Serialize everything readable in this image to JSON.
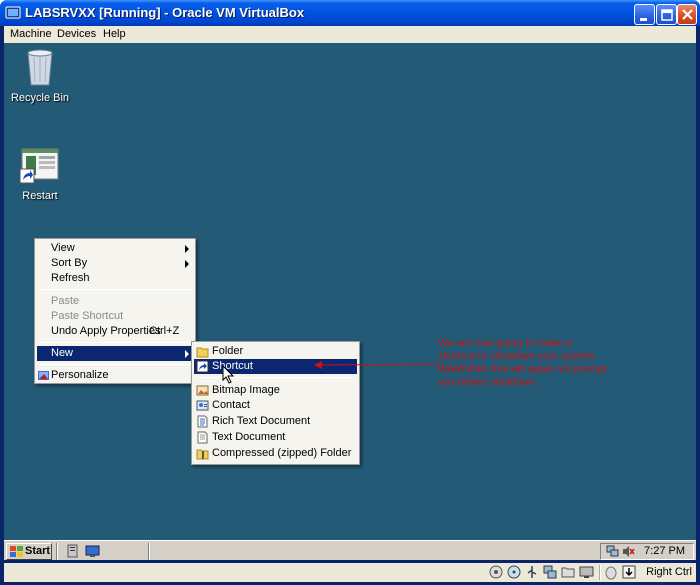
{
  "window": {
    "title": "LABSRVXX [Running] - Oracle VM VirtualBox"
  },
  "menubar": {
    "items": [
      "Machine",
      "Devices",
      "Help"
    ]
  },
  "desktop": {
    "icons": [
      {
        "label": "Recycle Bin",
        "icon": "recycle-bin-icon"
      },
      {
        "label": "Restart",
        "icon": "shortcut-icon"
      }
    ]
  },
  "context_menu": {
    "items": [
      {
        "label": "View",
        "submenu": true
      },
      {
        "label": "Sort By",
        "submenu": true
      },
      {
        "label": "Refresh"
      },
      {
        "label": "Paste",
        "disabled": true
      },
      {
        "label": "Paste Shortcut",
        "disabled": true
      },
      {
        "label": "Undo Apply Properties",
        "shortcut": "Ctrl+Z"
      },
      {
        "label": "New",
        "submenu": true,
        "highlighted": true
      },
      {
        "label": "Personalize"
      }
    ]
  },
  "new_submenu": {
    "items": [
      {
        "label": "Folder",
        "icon": "folder-icon"
      },
      {
        "label": "Shortcut",
        "icon": "shortcut-icon",
        "highlighted": true
      },
      {
        "label": "Bitmap Image",
        "icon": "bitmap-icon"
      },
      {
        "label": "Contact",
        "icon": "contact-icon"
      },
      {
        "label": "Rich Text Document",
        "icon": "document-icon"
      },
      {
        "label": "Text Document",
        "icon": "document-icon"
      },
      {
        "label": "Compressed (zipped) Folder",
        "icon": "zip-folder-icon"
      }
    ]
  },
  "annotation": {
    "text": "We are now going to make a shortcut to shutdown your system. WARNING this will again not prompt you before shutdown"
  },
  "taskbar": {
    "start_label": "Start",
    "clock": "7:27 PM"
  },
  "statusbar": {
    "host_key": "Right Ctrl"
  },
  "colors": {
    "desktop": "#235a76",
    "menu_highlight": "#0b2770",
    "annotation": "#d01010"
  }
}
